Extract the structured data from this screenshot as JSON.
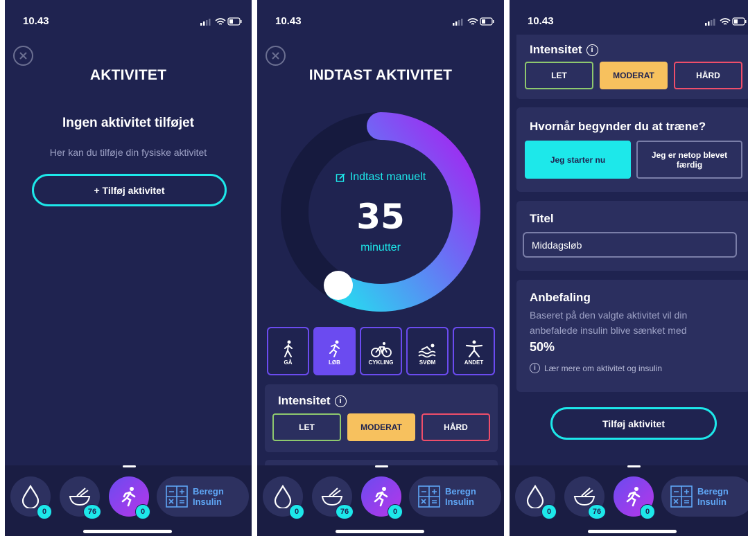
{
  "status": {
    "time": "10.43"
  },
  "colors": {
    "background": "#1f2350",
    "accent": "#1de8ea",
    "purple": "#6b4bf0",
    "moderate": "#f7c15e",
    "let": "#8ec86e",
    "hard": "#ef4e6a"
  },
  "tabbar": {
    "tabs": [
      {
        "icon": "drop-icon",
        "badge": "0"
      },
      {
        "icon": "bowl-icon",
        "badge": "76"
      },
      {
        "icon": "runner-icon",
        "badge": "0"
      }
    ],
    "beregn_label_1": "Beregn",
    "beregn_label_2": "Insulin"
  },
  "screen1": {
    "title": "AKTIVITET",
    "empty_title": "Ingen aktivitet tilføjet",
    "empty_desc": "Her kan du tilføje din fysiske aktivitet",
    "add_button": "+ Tilføj aktivitet"
  },
  "screen2": {
    "title": "INDTAST AKTIVITET",
    "manual_label": "Indtast manuelt",
    "minutes_value": "35",
    "minutes_unit": "minutter",
    "activities": [
      {
        "label": "GÅ",
        "icon": "walk-icon",
        "selected": false
      },
      {
        "label": "LØB",
        "icon": "run-icon",
        "selected": true
      },
      {
        "label": "CYKLING",
        "icon": "bike-icon",
        "selected": false
      },
      {
        "label": "SVØM",
        "icon": "swim-icon",
        "selected": false
      },
      {
        "label": "ANDET",
        "icon": "other-icon",
        "selected": false
      }
    ],
    "intensity": {
      "title": "Intensitet",
      "let": "LET",
      "moderat": "MODERAT",
      "hard": "HÅRD",
      "selected": "MODERAT"
    }
  },
  "screen3": {
    "intensity": {
      "title": "Intensitet",
      "let": "LET",
      "moderat": "MODERAT",
      "hard": "HÅRD",
      "selected": "MODERAT"
    },
    "start": {
      "question": "Hvornår begynder du at træne?",
      "now": "Jeg starter nu",
      "done": "Jeg er netop blevet færdig"
    },
    "title_section": {
      "label": "Titel",
      "value": "Middagsløb"
    },
    "recommendation": {
      "label": "Anbefaling",
      "text": "Baseret på den valgte aktivitet vil din anbefalede insulin blive sænket med",
      "percent": "50%",
      "learn_more": "Lær mere om aktivitet og insulin"
    },
    "add_button": "Tilføj aktivitet"
  }
}
